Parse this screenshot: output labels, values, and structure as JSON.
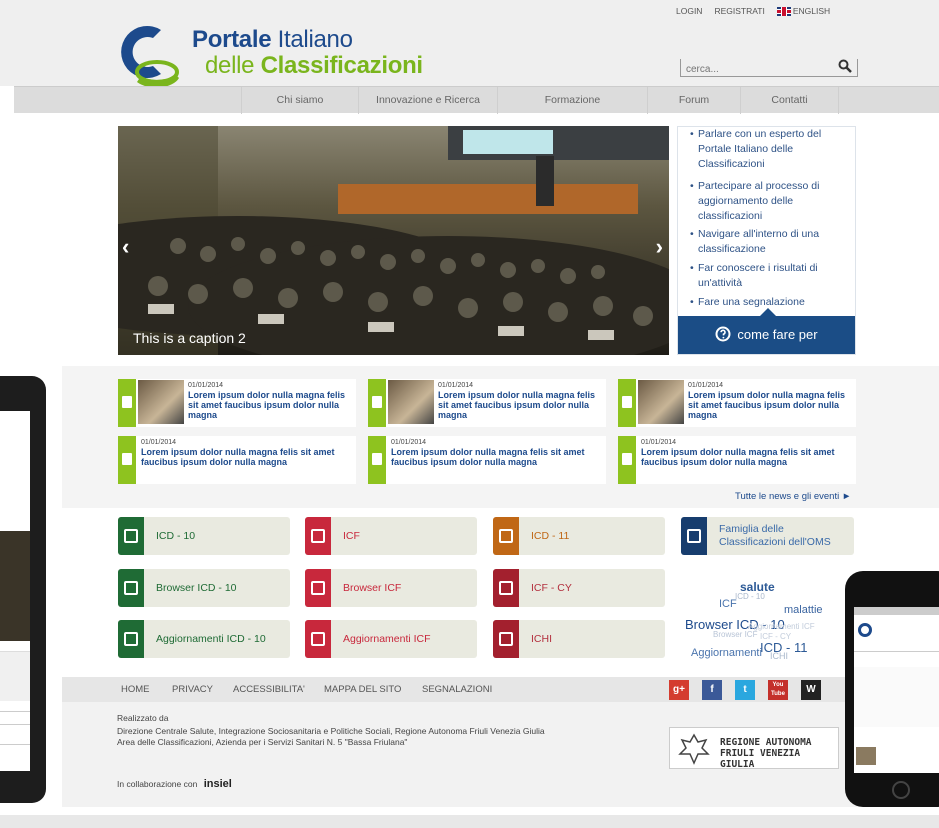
{
  "header": {
    "top_links": [
      "LOGIN",
      "REGISTRATI",
      "ENGLISH"
    ],
    "logo_line1_bold": "Portale",
    "logo_line1_rest": " Italiano",
    "logo_line2_pre": "delle ",
    "logo_line2_bold": "Classificazioni",
    "search_placeholder": "cerca..."
  },
  "nav": [
    "Chi siamo",
    "Innovazione e Ricerca",
    "Formazione",
    "Forum",
    "Contatti"
  ],
  "hero": {
    "caption": "This is a caption 2",
    "prev": "‹",
    "next": "›"
  },
  "howto": {
    "items": [
      "Parlare con un esperto del Portale Italiano delle Classificazioni",
      "Partecipare al processo di aggiornamento delle classificazioni",
      "Navigare all'interno di una classificazione",
      "Far conoscere i risultati di un'attività",
      "Fare una segnalazione"
    ],
    "button": "come fare per"
  },
  "news": [
    {
      "date": "01/01/2014",
      "text": "Lorem ipsum dolor nulla magna felis sit amet faucibus ipsum dolor nulla magna"
    },
    {
      "date": "01/01/2014",
      "text": "Lorem ipsum dolor nulla magna felis sit amet faucibus ipsum dolor nulla magna"
    },
    {
      "date": "01/01/2014",
      "text": "Lorem ipsum dolor nulla magna felis sit amet faucibus ipsum dolor nulla magna"
    },
    {
      "date": "01/01/2014",
      "text": "Lorem ipsum dolor nulla magna felis sit amet faucibus ipsum dolor nulla magna"
    },
    {
      "date": "01/01/2014",
      "text": "Lorem ipsum dolor nulla magna felis sit amet faucibus ipsum dolor nulla magna"
    },
    {
      "date": "01/01/2014",
      "text": "Lorem ipsum dolor nulla magna felis sit amet faucibus ipsum dolor nulla magna"
    }
  ],
  "all_news": "Tutte le news e gli eventi ►",
  "tiles": {
    "icd10": "ICD - 10",
    "icf": "ICF",
    "icd11": "ICD - 11",
    "famiglia_1": "Famiglia delle",
    "famiglia_2": "Classificazioni dell'OMS",
    "browser_icd10": "Browser ICD - 10",
    "browser_icf": "Browser ICF",
    "icf_cy": "ICF - CY",
    "agg_icd10": "Aggiornamenti ICD - 10",
    "agg_icf": "Aggiornamenti ICF",
    "ichi": "ICHI"
  },
  "tag_cloud": [
    "salute",
    "ICD - 10",
    "ICF",
    "malattie",
    "Browser ICD - 10",
    "Browser ICF",
    "Aggiornamenti",
    "ICD - 11",
    "ICHI",
    "Aggiornamenti ICF",
    "ICF - CY"
  ],
  "footer": {
    "links": [
      "HOME",
      "PRIVACY",
      "ACCESSIBILITA'",
      "MAPPA DEL SITO",
      "SEGNALAZIONI"
    ],
    "social": [
      "g+",
      "f",
      "t",
      "You Tube",
      "W"
    ],
    "realizzato": "Realizzato da",
    "line1": "Direzione Centrale Salute, Integrazione Sociosanitaria e Politiche Sociali, Regione Autonoma Friuli Venezia Giulia",
    "line2": "Area delle Classificazioni, Azienda per i Servizi Sanitari N. 5 \"Bassa Friulana\"",
    "collab": "In collaborazione con",
    "insiel": "insiel",
    "regione_1": "REGIONE AUTONOMA",
    "regione_2": "FRIULI VENEZIA GIULIA"
  },
  "colors": {
    "brand_blue": "#1d4a8c",
    "brand_green": "#7ab51d",
    "howto_blue": "#1b4d86"
  }
}
